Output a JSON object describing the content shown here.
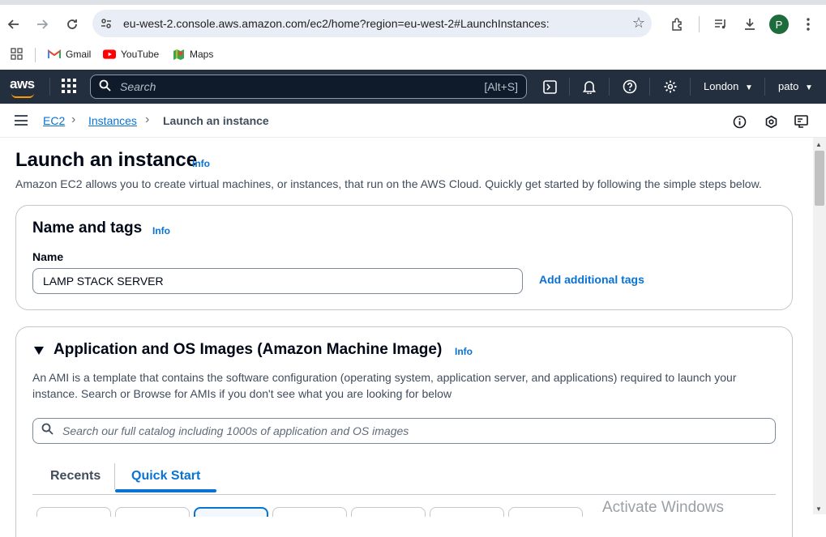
{
  "browser": {
    "url": "eu-west-2.console.aws.amazon.com/ec2/home?region=eu-west-2#LaunchInstances:",
    "profile_initial": "P",
    "bookmarks": [
      {
        "label": "Gmail",
        "icon": "gmail-icon"
      },
      {
        "label": "YouTube",
        "icon": "youtube-icon"
      },
      {
        "label": "Maps",
        "icon": "maps-icon"
      }
    ]
  },
  "aws_nav": {
    "logo": "aws",
    "search_placeholder": "Search",
    "search_shortcut": "[Alt+S]",
    "region": "London",
    "user": "pato"
  },
  "breadcrumb": {
    "items": [
      "EC2",
      "Instances",
      "Launch an instance"
    ]
  },
  "page": {
    "title": "Launch an instance",
    "info": "Info",
    "description": "Amazon EC2 allows you to create virtual machines, or instances, that run on the AWS Cloud. Quickly get started by following the simple steps below."
  },
  "name_tags": {
    "title": "Name and tags",
    "info": "Info",
    "name_label": "Name",
    "name_value": "LAMP STACK SERVER",
    "add_tags_link": "Add additional tags"
  },
  "ami": {
    "title": "Application and OS Images (Amazon Machine Image)",
    "info": "Info",
    "description": "An AMI is a template that contains the software configuration (operating system, application server, and applications) required to launch your instance. Search or Browse for AMIs if you don't see what you are looking for below",
    "search_placeholder": "Search our full catalog including 1000s of application and OS images",
    "tabs": [
      "Recents",
      "Quick Start"
    ],
    "active_tab": "Quick Start"
  },
  "watermark": "Activate Windows",
  "colors": {
    "aws_nav_bg": "#232f3e",
    "link_blue": "#0972d3",
    "aws_orange": "#ff9900"
  }
}
